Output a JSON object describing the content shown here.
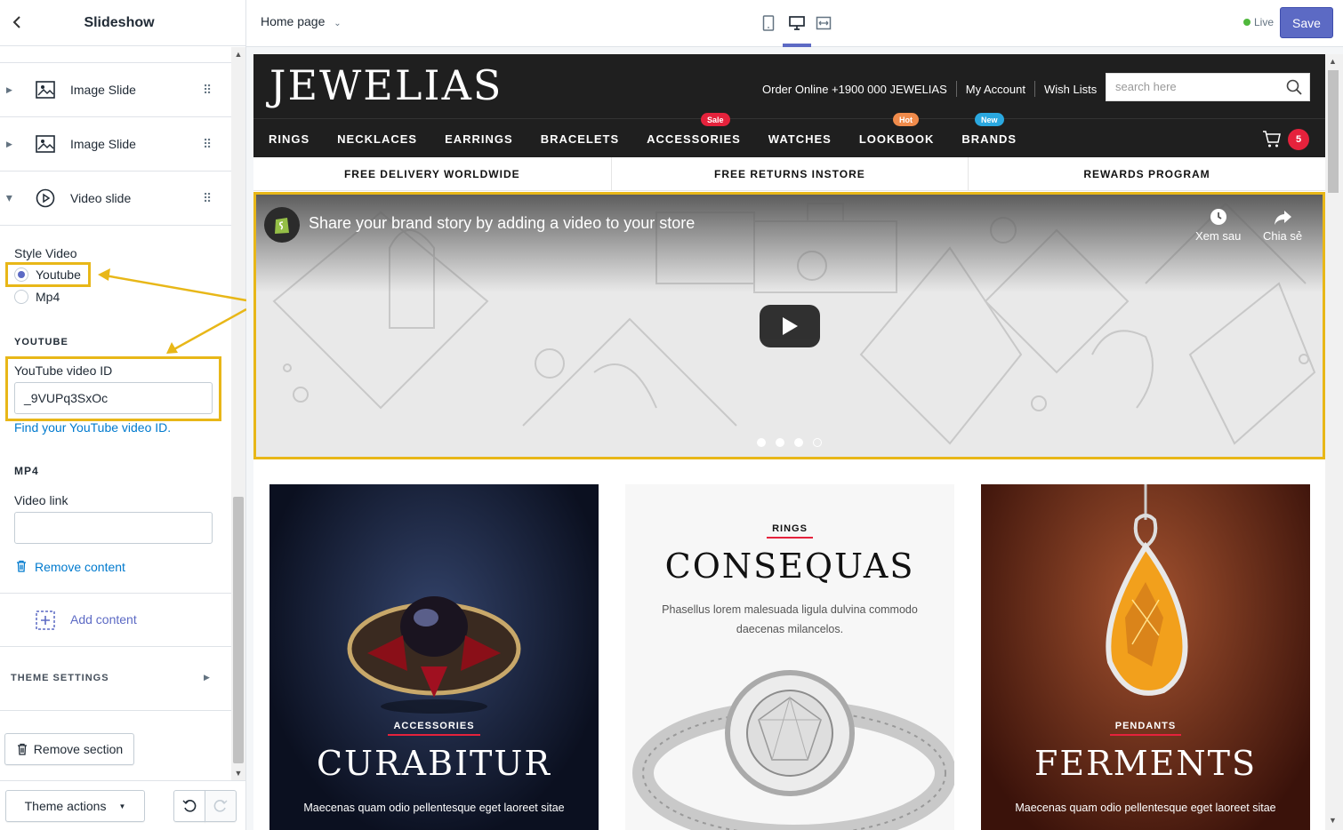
{
  "sidebar": {
    "title": "Slideshow",
    "blocks": [
      {
        "label": "Image Slide"
      },
      {
        "label": "Image Slide"
      },
      {
        "label": "Video slide"
      }
    ],
    "style_video_label": "Style Video",
    "style_options": [
      {
        "label": "Youtube",
        "selected": true
      },
      {
        "label": "Mp4",
        "selected": false
      }
    ],
    "youtube_heading": "YOUTUBE",
    "youtube_id_label": "YouTube video ID",
    "youtube_id_value": "_9VUPq3SxOc",
    "youtube_help_link": "Find your YouTube video ID.",
    "mp4_heading": "MP4",
    "video_link_label": "Video link",
    "video_link_value": "",
    "remove_content": "Remove content",
    "add_content": "Add content",
    "theme_settings": "THEME SETTINGS",
    "remove_section": "Remove section",
    "theme_actions": "Theme actions"
  },
  "topbar": {
    "page_select": "Home page",
    "live_label": "Live",
    "save_label": "Save"
  },
  "store": {
    "logo": "JEWELIAS",
    "order_online": "Order Online +1900 000 JEWELIAS",
    "my_account": "My Account",
    "wish_lists": "Wish Lists",
    "search_placeholder": "search here",
    "nav": [
      "RINGS",
      "NECKLACES",
      "EARRINGS",
      "BRACELETS",
      "ACCESSORIES",
      "WATCHES",
      "LOOKBOOK",
      "BRANDS"
    ],
    "badges": {
      "sale": "Sale",
      "hot": "Hot",
      "new": "New"
    },
    "badge_colors": {
      "sale": "#e5223c",
      "hot": "#f08b4b",
      "new": "#2aa8e0"
    },
    "cart_count": "5",
    "promos": [
      "FREE DELIVERY WORLDWIDE",
      "FREE RETURNS INSTORE",
      "REWARDS PROGRAM"
    ],
    "video": {
      "title": "Share your brand story by adding a video to your store",
      "watch_later": "Xem sau",
      "share": "Chia sẻ",
      "slide_count": 4,
      "active_slide": 3
    },
    "cards": [
      {
        "tag": "ACCESSORIES",
        "title": "CURABITUR",
        "desc": "Maecenas quam odio pellentesque eget laoreet sitae"
      },
      {
        "tag": "RINGS",
        "title": "CONSEQUAS",
        "desc": "Phasellus lorem malesuada ligula dulvina commodo daecenas milancelos."
      },
      {
        "tag": "PENDANTS",
        "title": "FERMENTS",
        "desc": "Maecenas quam odio pellentesque eget laoreet sitae"
      }
    ]
  },
  "colors": {
    "accent": "#5c6ac4",
    "highlight": "#e8b718",
    "link": "#007ace"
  }
}
